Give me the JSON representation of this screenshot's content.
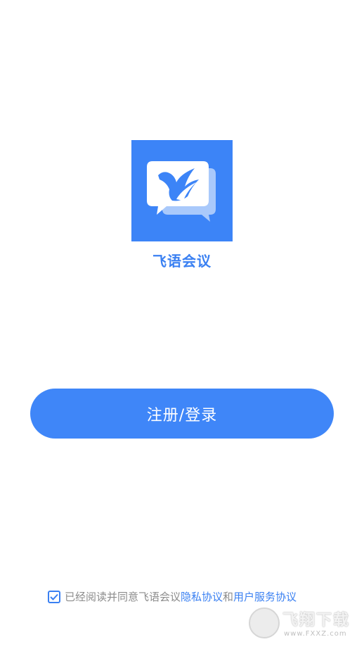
{
  "app": {
    "name": "飞语会议",
    "logo_icon": "bird-chat-bubble-icon",
    "brand_color": "#3c84f7"
  },
  "login": {
    "button_label": "注册/登录"
  },
  "agreement": {
    "checked": true,
    "prefix_text": "已经阅读并同意飞语会议",
    "privacy_link": "隐私协议",
    "connector": "和",
    "service_link": "用户服务协议"
  },
  "watermark": {
    "title": "飞翔下载",
    "url": "www.FXXZ.com"
  }
}
